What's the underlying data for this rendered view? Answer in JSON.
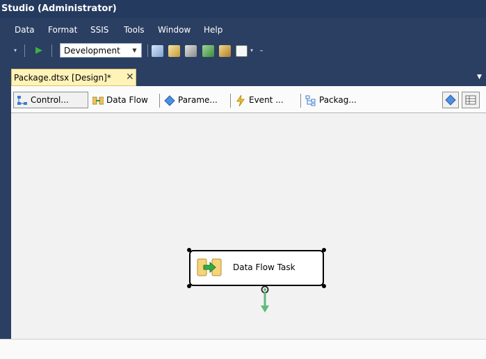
{
  "window": {
    "title": "Studio (Administrator)"
  },
  "menubar": {
    "items": [
      "Data",
      "Format",
      "SSIS",
      "Tools",
      "Window",
      "Help"
    ]
  },
  "toolbar": {
    "config_dropdown": {
      "value": "Development"
    },
    "overflow": "₌"
  },
  "document_tab": {
    "label": "Package.dtsx [Design]*",
    "close": "✕"
  },
  "designer_tabs": [
    {
      "label": "Control...",
      "icon": "control-flow-icon",
      "active": true
    },
    {
      "label": "Data Flow",
      "icon": "data-flow-icon",
      "active": false
    },
    {
      "label": "Parame...",
      "icon": "parameters-icon",
      "active": false
    },
    {
      "label": "Event ...",
      "icon": "event-handlers-icon",
      "active": false
    },
    {
      "label": "Packag...",
      "icon": "package-explorer-icon",
      "active": false
    }
  ],
  "canvas": {
    "task": {
      "label": "Data Flow Task",
      "icon": "data-flow-task-icon"
    },
    "colors": {
      "precedence_arrow": "#5fb97c",
      "title_bg": "#243a5f",
      "active_tab_bg": "#fff3b8"
    }
  }
}
